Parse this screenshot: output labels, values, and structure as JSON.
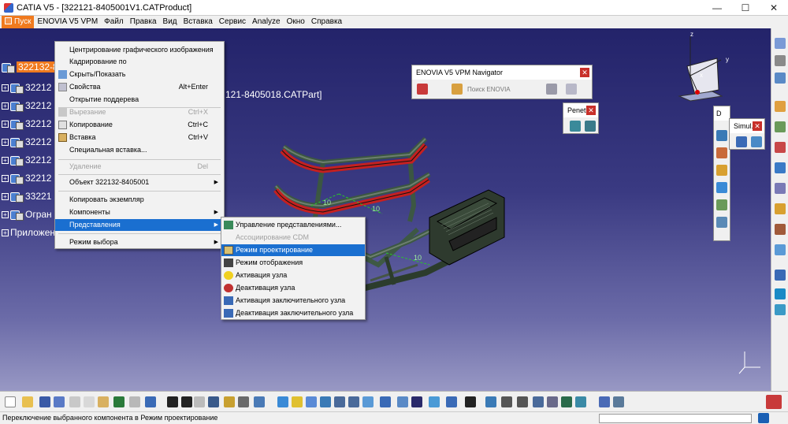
{
  "window": {
    "title": "CATIA V5 - [322121-8405001V1.CATProduct]",
    "minimize": "—",
    "maximize": "☐",
    "close": "✕"
  },
  "menubar": {
    "items": [
      "Пуск",
      "ENOVIA V5 VPM",
      "Файл",
      "Правка",
      "Вид",
      "Вставка",
      "Сервис",
      "Analyze",
      "Окно",
      "Справка"
    ]
  },
  "tree": {
    "root": "322132-8405001",
    "children": [
      "32212",
      "32212",
      "32212",
      "32212",
      "32212",
      "32212",
      "33221"
    ],
    "constraints": "Огран",
    "applications": "Приложен"
  },
  "viewport": {
    "part_title": "121-8405018.CATPart]",
    "dimension_labels": [
      "10",
      "10",
      "10"
    ]
  },
  "context_menu": {
    "items": [
      {
        "label": "Центрирование графического изображения",
        "shortcut": "",
        "disabled": false,
        "submenu": false
      },
      {
        "label": "Кадрирование по",
        "shortcut": "",
        "disabled": false,
        "submenu": false
      },
      {
        "label": "Скрыть/Показать",
        "shortcut": "",
        "disabled": false,
        "submenu": false
      },
      {
        "label": "Свойства",
        "shortcut": "Alt+Enter",
        "disabled": false,
        "submenu": false
      },
      {
        "label": "Открытие поддерева",
        "shortcut": "",
        "disabled": false,
        "submenu": false
      },
      {
        "label": "Вырезание",
        "shortcut": "Ctrl+X",
        "disabled": true,
        "submenu": false
      },
      {
        "label": "Копирование",
        "shortcut": "Ctrl+C",
        "disabled": false,
        "submenu": false
      },
      {
        "label": "Вставка",
        "shortcut": "Ctrl+V",
        "disabled": false,
        "submenu": false
      },
      {
        "label": "Специальная вставка...",
        "shortcut": "",
        "disabled": false,
        "submenu": false
      },
      {
        "label": "Удаление",
        "shortcut": "Del",
        "disabled": true,
        "submenu": false
      },
      {
        "label": "Объект 322132-8405001",
        "shortcut": "",
        "disabled": false,
        "submenu": true
      },
      {
        "label": "Копировать экземпляр",
        "shortcut": "",
        "disabled": false,
        "submenu": false
      },
      {
        "label": "Компоненты",
        "shortcut": "",
        "disabled": false,
        "submenu": true
      },
      {
        "label": "Представления",
        "shortcut": "",
        "disabled": false,
        "submenu": true,
        "highlighted": true
      },
      {
        "label": "Режим выбора",
        "shortcut": "",
        "disabled": false,
        "submenu": true
      }
    ]
  },
  "submenu": {
    "items": [
      {
        "label": "Управление представлениями...",
        "disabled": false
      },
      {
        "label": "Ассоциирование CDM",
        "disabled": true
      },
      {
        "label": "Режим проектирование",
        "disabled": false,
        "highlighted": true
      },
      {
        "label": "Режим отображения",
        "disabled": false
      },
      {
        "label": "Активация узла",
        "disabled": false
      },
      {
        "label": "Деактивация узла",
        "disabled": false
      },
      {
        "label": "Активация заключительного узла",
        "disabled": false
      },
      {
        "label": "Деактивация заключительного узла",
        "disabled": false
      }
    ]
  },
  "toolbars": {
    "enovia_title": "ENOVIA V5 VPM Navigator",
    "enovia_search": "Поиск ENOVIA",
    "penetr_title": "Penetr...",
    "simul_title": "Simul...",
    "small_title": "D"
  },
  "status": {
    "text": "Переключение выбранного компонента в Режим проектирование"
  },
  "compass": {
    "x": "x",
    "y": "y",
    "z": "z"
  }
}
